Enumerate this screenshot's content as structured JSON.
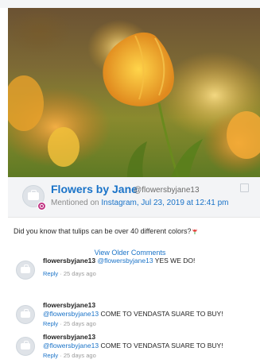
{
  "post": {
    "page_name": "Flowers by Jane",
    "handle": "@flowersbyjane13",
    "handle_separator": "·",
    "mention_prefix": "Mentioned on ",
    "mention_network": "Instagram",
    "mention_date": ", Jul 23, 2019 at 12:41 pm",
    "text": "Did you know that tulips can be over 40 different colors?",
    "view_older_label": "View Older Comments"
  },
  "comments": [
    {
      "user": "flowersbyjane13",
      "mention": "@flowersbyjane13",
      "text": "YES WE DO!",
      "reply_label": "Reply",
      "meta_sep": "·",
      "age": "25 days ago"
    },
    {
      "user": "flowersbyjane13",
      "mention": "@flowersbyjane13",
      "text": "COME TO VENDASTA SUARE TO BUY!",
      "reply_label": "Reply",
      "meta_sep": "·",
      "age": "25 days ago"
    },
    {
      "user": "flowersbyjane13",
      "mention": "@flowersbyjane13",
      "text": "COME TO VENDASTA SUARE TO BUY!",
      "reply_label": "Reply",
      "meta_sep": "·",
      "age": "25 days ago"
    }
  ],
  "icons": {
    "network": "instagram-icon",
    "avatar": "briefcase-icon",
    "edit": "edit-icon",
    "emoji": "tulip-icon"
  },
  "colors": {
    "link": "#1a73c8",
    "instagram": "#c13584"
  }
}
